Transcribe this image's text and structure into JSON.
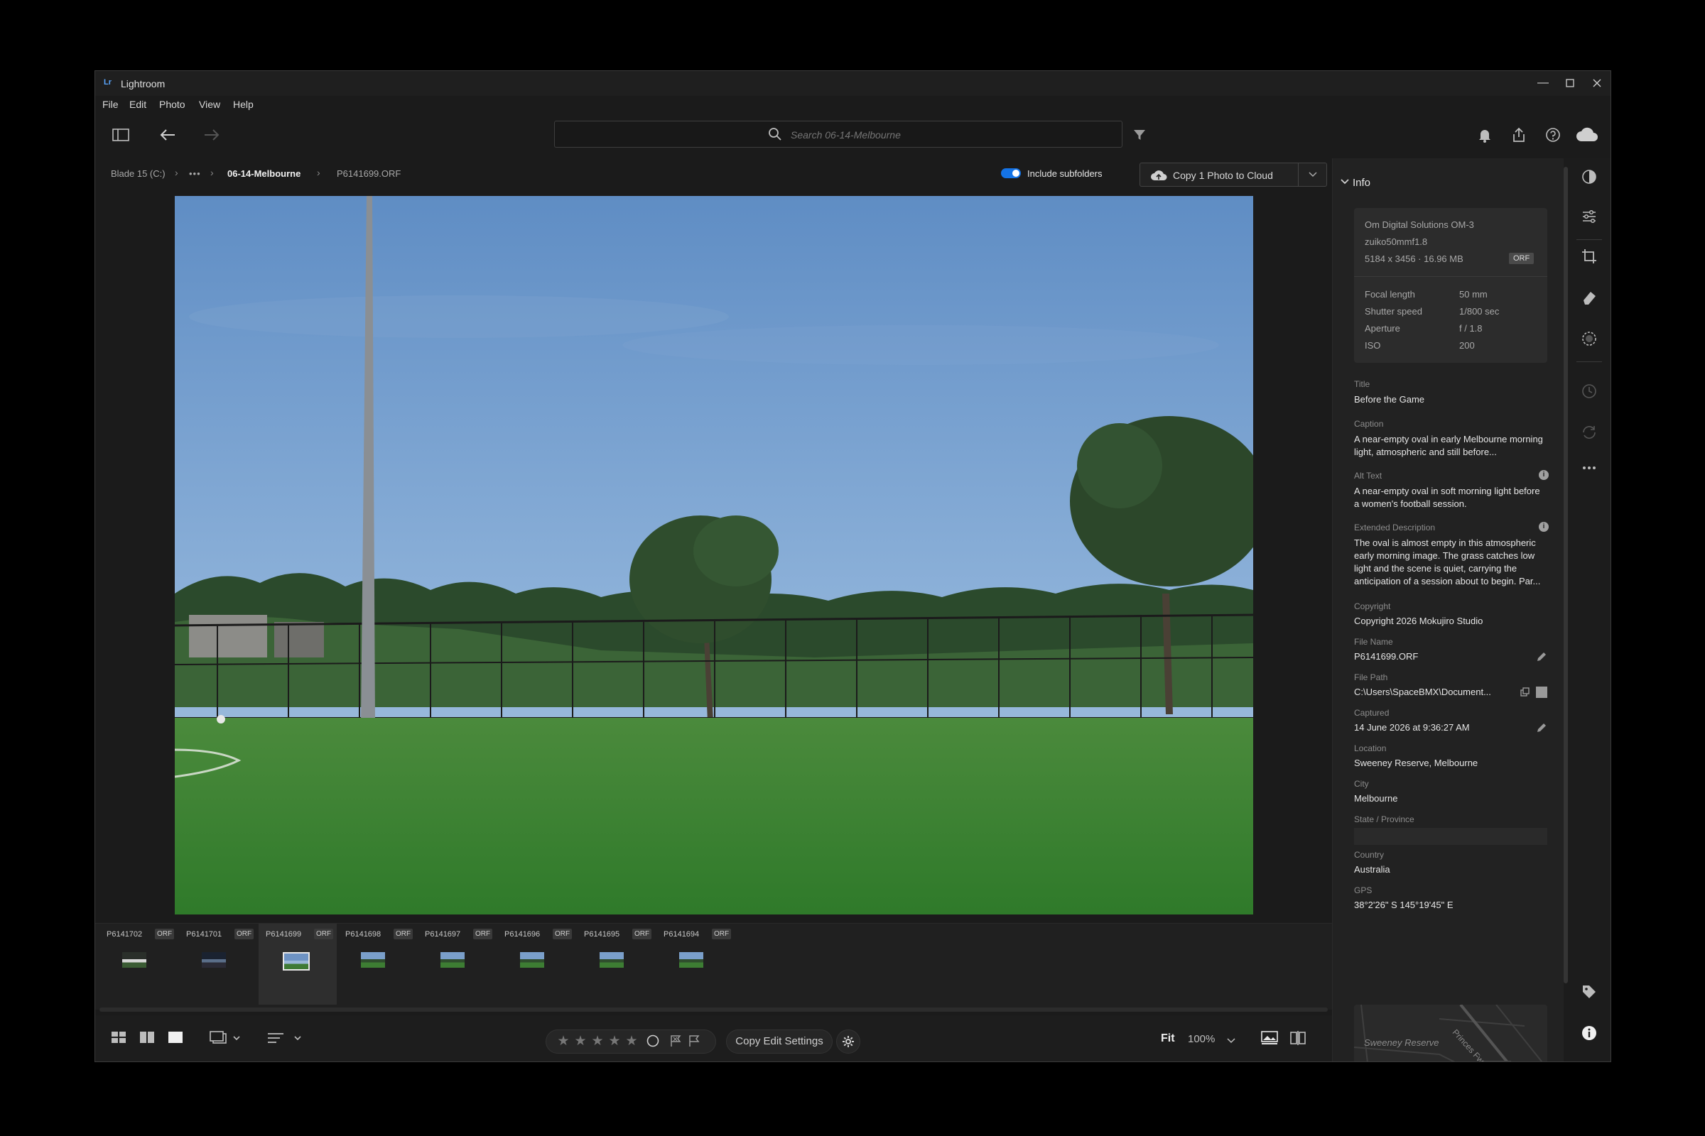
{
  "app": {
    "title": "Lightroom",
    "logo": "Lr"
  },
  "menu": [
    "File",
    "Edit",
    "Photo",
    "View",
    "Help"
  ],
  "search": {
    "placeholder": "Search 06-14-Melbourne"
  },
  "breadcrumb": {
    "drive": "Blade 15 (C:)",
    "ellipsis": "•••",
    "folder": "06-14-Melbourne",
    "file": "P6141699.ORF"
  },
  "include_subfolders": {
    "label": "Include subfolders",
    "enabled": true
  },
  "copy_to_cloud": {
    "label": "Copy 1 Photo to Cloud"
  },
  "filmstrip": [
    {
      "name": "P6141702",
      "badge": "ORF",
      "selected": false,
      "tone": "dark"
    },
    {
      "name": "P6141701",
      "badge": "ORF",
      "selected": false,
      "tone": "night"
    },
    {
      "name": "P6141699",
      "badge": "ORF",
      "selected": true,
      "tone": "sky"
    },
    {
      "name": "P6141698",
      "badge": "ORF",
      "selected": false,
      "tone": "field"
    },
    {
      "name": "P6141697",
      "badge": "ORF",
      "selected": false,
      "tone": "field"
    },
    {
      "name": "P6141696",
      "badge": "ORF",
      "selected": false,
      "tone": "field"
    },
    {
      "name": "P6141695",
      "badge": "ORF",
      "selected": false,
      "tone": "field"
    },
    {
      "name": "P6141694",
      "badge": "ORF",
      "selected": false,
      "tone": "field"
    }
  ],
  "bottom": {
    "copy_edit_label": "Copy Edit Settings",
    "fit_label": "Fit",
    "zoom_label": "100%",
    "stars": [
      "★",
      "★",
      "★",
      "★",
      "★"
    ]
  },
  "info": {
    "header": "Info",
    "camera": "Om Digital Solutions OM-3",
    "lens": "zuiko50mmf1.8",
    "dims": "5184 x 3456  ·  16.96 MB",
    "badge": "ORF",
    "exif": [
      {
        "key": "Focal length",
        "value": "50 mm"
      },
      {
        "key": "Shutter speed",
        "value": "1/800 sec"
      },
      {
        "key": "Aperture",
        "value": "f / 1.8"
      },
      {
        "key": "ISO",
        "value": "200"
      }
    ],
    "title_label": "Title",
    "title": "Before the Game",
    "caption_label": "Caption",
    "caption": "A near-empty oval in early Melbourne morning light, atmospheric and still before...",
    "alt_label": "Alt Text",
    "alt": "A near-empty oval in soft morning light before a women's football session.",
    "ext_label": "Extended Description",
    "ext": "The oval is almost empty in this atmospheric early morning image. The grass catches low light and the scene is quiet, carrying the anticipation of a session about to begin. Par...",
    "copyright_label": "Copyright",
    "copyright": "Copyright 2026 Mokujiro Studio",
    "filename_label": "File Name",
    "filename": "P6141699.ORF",
    "filepath_label": "File Path",
    "filepath": "C:\\Users\\SpaceBMX\\Document...",
    "captured_label": "Captured",
    "captured": "14 June 2026 at 9:36:27 AM",
    "location_label": "Location",
    "location": "Sweeney Reserve, Melbourne",
    "city_label": "City",
    "city": "Melbourne",
    "state_label": "State / Province",
    "country_label": "Country",
    "country": "Australia",
    "gps_label": "GPS",
    "gps": "38°2'26\" S 145°19'45\" E",
    "map_label_1": "Sweeney Reserve",
    "map_label_2": "Princes Fwy"
  },
  "colors": {
    "accent": "#1473e6",
    "background": "#1b1b1b",
    "panel": "#222222",
    "pin": "#1473e6"
  }
}
